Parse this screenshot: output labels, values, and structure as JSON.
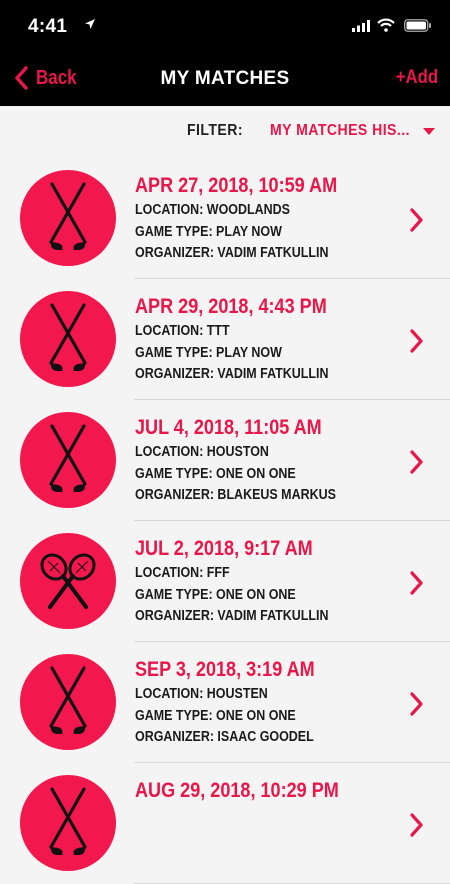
{
  "status": {
    "time": "4:41"
  },
  "nav": {
    "back_label": "Back",
    "title": "MY MATCHES",
    "add_label": "+Add"
  },
  "filter": {
    "label": "FILTER:",
    "value": "MY MATCHES HIS..."
  },
  "colors": {
    "accent": "#e8174a",
    "avatar_bg": "#f2184d",
    "bar_bg": "#000000",
    "page_bg": "#f4f4f4"
  },
  "matches": [
    {
      "date": "APR 27, 2018, 10:59 AM",
      "location": "LOCATION: WOODLANDS",
      "game_type": "GAME TYPE: PLAY NOW",
      "organizer": "ORGANIZER: VADIM FATKULLIN",
      "icon": "golf-clubs-icon"
    },
    {
      "date": "APR 29, 2018, 4:43 PM",
      "location": "LOCATION: TTT",
      "game_type": "GAME TYPE: PLAY NOW",
      "organizer": "ORGANIZER: VADIM FATKULLIN",
      "icon": "golf-clubs-icon"
    },
    {
      "date": "JUL 4, 2018, 11:05 AM",
      "location": "LOCATION: HOUSTON",
      "game_type": "GAME TYPE: ONE ON ONE",
      "organizer": "ORGANIZER: BLAKEUS MARKUS",
      "icon": "golf-clubs-icon"
    },
    {
      "date": "JUL 2, 2018, 9:17 AM",
      "location": "LOCATION: FFF",
      "game_type": "GAME TYPE: ONE ON ONE",
      "organizer": "ORGANIZER: VADIM FATKULLIN",
      "icon": "tennis-rackets-icon"
    },
    {
      "date": "SEP 3, 2018, 3:19 AM",
      "location": "LOCATION: HOUSTEN",
      "game_type": "GAME TYPE: ONE ON ONE",
      "organizer": "ORGANIZER: ISAAC GOODEL",
      "icon": "golf-clubs-icon"
    },
    {
      "date": "AUG 29, 2018, 10:29 PM",
      "location": "",
      "game_type": "",
      "organizer": "",
      "icon": "golf-clubs-icon"
    }
  ]
}
